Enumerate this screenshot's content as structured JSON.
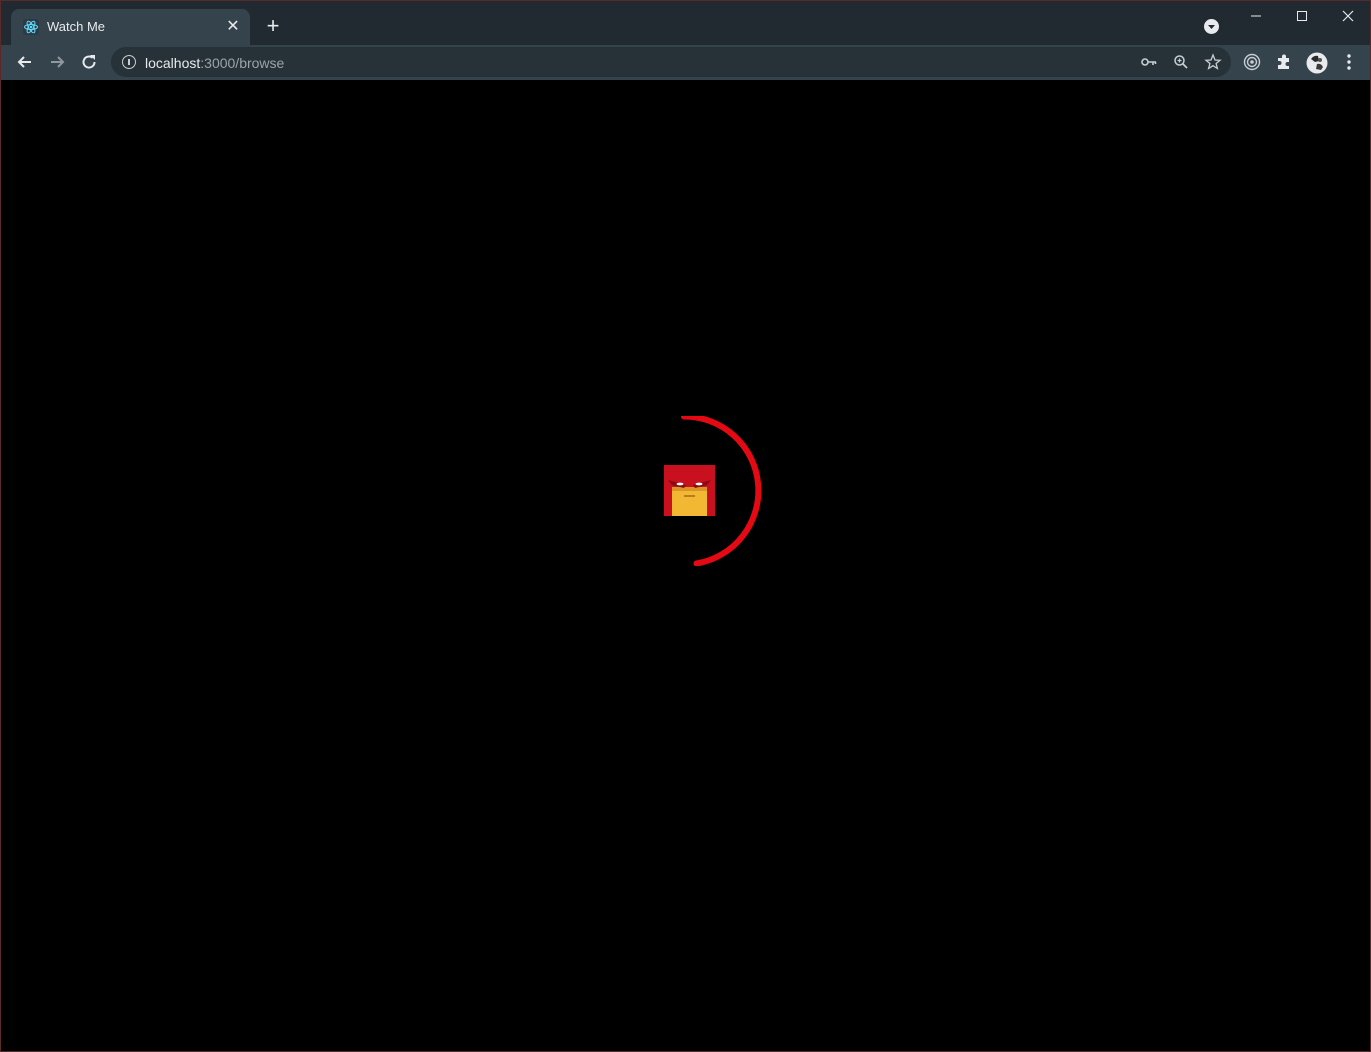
{
  "browser": {
    "tab": {
      "title": "Watch Me",
      "favicon": "react-atom-icon"
    },
    "address_bar": {
      "host": "localhost",
      "path": ":3000/browse"
    }
  },
  "page": {
    "loader": {
      "accent_color": "#e50914",
      "logo": "angry-red-hood-face-logo"
    }
  },
  "colors": {
    "tabstrip_bg": "#202a30",
    "toolbar_bg": "#35434c",
    "content_bg": "#000000"
  }
}
